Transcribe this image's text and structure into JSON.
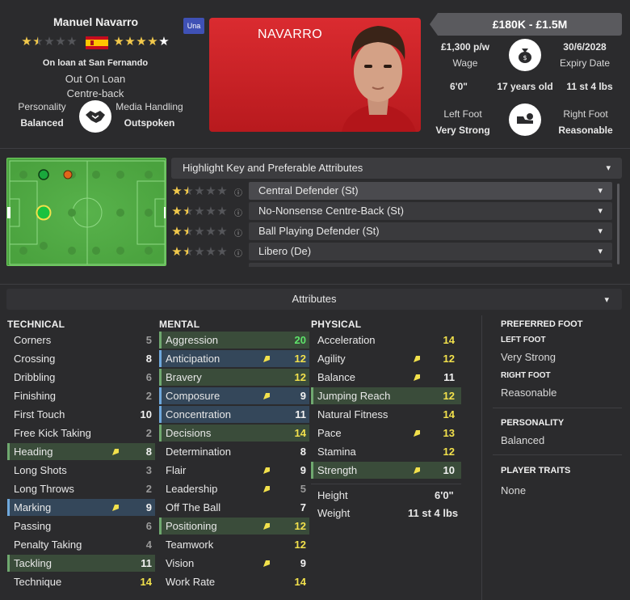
{
  "player": {
    "name": "Manuel Navarro",
    "loan_status": "On loan at San Fernando",
    "status": "Out On Loan",
    "position": "Centre-back",
    "card_name": "NAVARRO",
    "club_badge": "Una",
    "current_ability_stars": 1.5,
    "potential_ability_stars": 4.5
  },
  "personality": {
    "label": "Personality",
    "value": "Balanced"
  },
  "media": {
    "label": "Media Handling",
    "value": "Outspoken"
  },
  "contract": {
    "value_range": "£180K - £1.5M",
    "wage": "£1,300 p/w",
    "wage_label": "Wage",
    "expiry": "30/6/2028",
    "expiry_label": "Expiry Date",
    "height": "6'0\"",
    "age": "17 years old",
    "weight": "11 st 4 lbs",
    "left_foot_label": "Left Foot",
    "left_foot": "Very Strong",
    "right_foot_label": "Right Foot",
    "right_foot": "Reasonable"
  },
  "roles": {
    "header": "Highlight Key and Preferable Attributes",
    "items": [
      {
        "label": "Central Defender (St)",
        "stars": 1.5
      },
      {
        "label": "No-Nonsense Centre-Back (St)",
        "stars": 1.5
      },
      {
        "label": "Ball Playing Defender (St)",
        "stars": 1.5
      },
      {
        "label": "Libero (De)",
        "stars": 1.5
      }
    ]
  },
  "attributes_header": "Attributes",
  "technical": {
    "title": "TECHNICAL",
    "rows": [
      {
        "label": "Corners",
        "value": "5"
      },
      {
        "label": "Crossing",
        "value": "8"
      },
      {
        "label": "Dribbling",
        "value": "6"
      },
      {
        "label": "Finishing",
        "value": "2"
      },
      {
        "label": "First Touch",
        "value": "10"
      },
      {
        "label": "Free Kick Taking",
        "value": "2"
      },
      {
        "label": "Heading",
        "value": "8"
      },
      {
        "label": "Long Shots",
        "value": "3"
      },
      {
        "label": "Long Throws",
        "value": "2"
      },
      {
        "label": "Marking",
        "value": "9"
      },
      {
        "label": "Passing",
        "value": "6"
      },
      {
        "label": "Penalty Taking",
        "value": "4"
      },
      {
        "label": "Tackling",
        "value": "11"
      },
      {
        "label": "Technique",
        "value": "14"
      }
    ]
  },
  "mental": {
    "title": "MENTAL",
    "rows": [
      {
        "label": "Aggression",
        "value": "20"
      },
      {
        "label": "Anticipation",
        "value": "12"
      },
      {
        "label": "Bravery",
        "value": "12"
      },
      {
        "label": "Composure",
        "value": "9"
      },
      {
        "label": "Concentration",
        "value": "11"
      },
      {
        "label": "Decisions",
        "value": "14"
      },
      {
        "label": "Determination",
        "value": "8"
      },
      {
        "label": "Flair",
        "value": "9"
      },
      {
        "label": "Leadership",
        "value": "5"
      },
      {
        "label": "Off The Ball",
        "value": "7"
      },
      {
        "label": "Positioning",
        "value": "12"
      },
      {
        "label": "Teamwork",
        "value": "12"
      },
      {
        "label": "Vision",
        "value": "9"
      },
      {
        "label": "Work Rate",
        "value": "14"
      }
    ]
  },
  "physical": {
    "title": "PHYSICAL",
    "rows": [
      {
        "label": "Acceleration",
        "value": "14"
      },
      {
        "label": "Agility",
        "value": "12"
      },
      {
        "label": "Balance",
        "value": "11"
      },
      {
        "label": "Jumping Reach",
        "value": "12"
      },
      {
        "label": "Natural Fitness",
        "value": "14"
      },
      {
        "label": "Pace",
        "value": "13"
      },
      {
        "label": "Stamina",
        "value": "12"
      },
      {
        "label": "Strength",
        "value": "10"
      }
    ],
    "height_label": "Height",
    "height_value": "6'0\"",
    "weight_label": "Weight",
    "weight_value": "11 st 4 lbs"
  },
  "sidebar": {
    "preferred_foot_title": "PREFERRED FOOT",
    "left_foot_title": "LEFT FOOT",
    "left_foot_value": "Very Strong",
    "right_foot_title": "RIGHT FOOT",
    "right_foot_value": "Reasonable",
    "personality_title": "PERSONALITY",
    "personality_value": "Balanced",
    "traits_title": "PLAYER TRAITS",
    "traits_value": "None"
  },
  "colors": {
    "accent_yellow": "#f2e14c",
    "accent_green": "#5ee46a",
    "card_red": "#d81e23",
    "pitch_green": "#4fa943"
  }
}
